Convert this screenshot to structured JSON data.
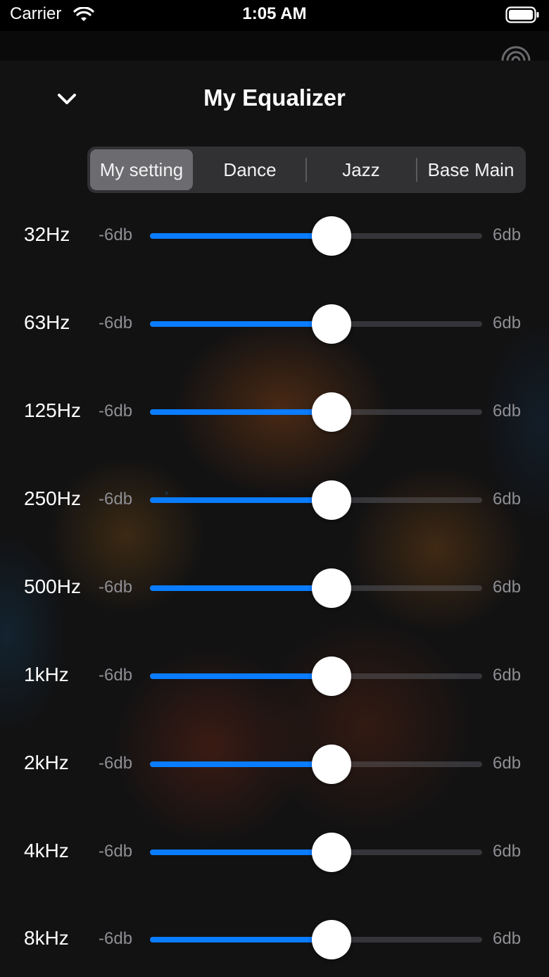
{
  "status_bar": {
    "carrier": "Carrier",
    "time": "1:05 AM"
  },
  "header": {
    "title": "My Equalizer"
  },
  "presets": [
    {
      "label": "My setting",
      "selected": true
    },
    {
      "label": "Dance",
      "selected": false
    },
    {
      "label": "Jazz",
      "selected": false
    },
    {
      "label": "Base Main",
      "selected": false
    }
  ],
  "bands": [
    {
      "label": "32Hz",
      "min": "-6db",
      "max": "6db",
      "value_fraction": 0.5
    },
    {
      "label": "63Hz",
      "min": "-6db",
      "max": "6db",
      "value_fraction": 0.5
    },
    {
      "label": "125Hz",
      "min": "-6db",
      "max": "6db",
      "value_fraction": 0.5
    },
    {
      "label": "250Hz",
      "min": "-6db",
      "max": "6db",
      "value_fraction": 0.5
    },
    {
      "label": "500Hz",
      "min": "-6db",
      "max": "6db",
      "value_fraction": 0.5
    },
    {
      "label": "1kHz",
      "min": "-6db",
      "max": "6db",
      "value_fraction": 0.5
    },
    {
      "label": "2kHz",
      "min": "-6db",
      "max": "6db",
      "value_fraction": 0.5
    },
    {
      "label": "4kHz",
      "min": "-6db",
      "max": "6db",
      "value_fraction": 0.5
    },
    {
      "label": "8kHz",
      "min": "-6db",
      "max": "6db",
      "value_fraction": 0.5
    }
  ],
  "colors": {
    "accent": "#0a7cff",
    "background": "#121213",
    "segment_active": "#6b6b70"
  },
  "icons": {
    "close": "chevron-down-icon",
    "wifi": "wifi-icon",
    "battery": "battery-icon",
    "cast": "cast-icon"
  }
}
